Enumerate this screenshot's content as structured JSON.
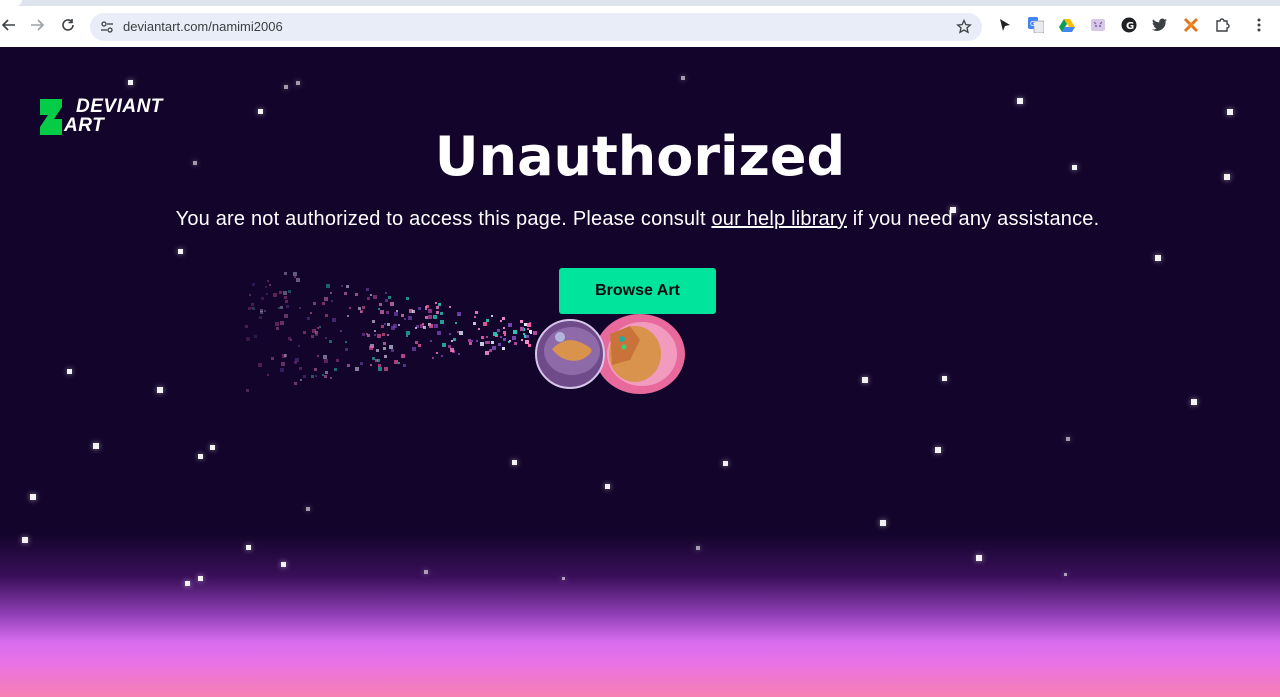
{
  "browser": {
    "url": "deviantart.com/namimi2006",
    "extensions": [
      "cursor-extension-icon",
      "google-translate-icon",
      "google-drive-icon",
      "cat-extension-icon",
      "github-icon",
      "twitter-icon",
      "metamask-icon",
      "puzzle-extensions-icon",
      "more-menu-icon"
    ]
  },
  "logo": {
    "line1": "DEVIANT",
    "line2": "ART",
    "color": "#05cc47"
  },
  "page": {
    "title": "Unauthorized",
    "message_before": "You are not authorized to access this page. Please consult ",
    "help_link": "our help library",
    "message_after": " if you need any assistance.",
    "browse_button": "Browse Art"
  },
  "colors": {
    "background": "#12042a",
    "accent": "#00e59b",
    "horizon_glow": "#e872e8"
  }
}
